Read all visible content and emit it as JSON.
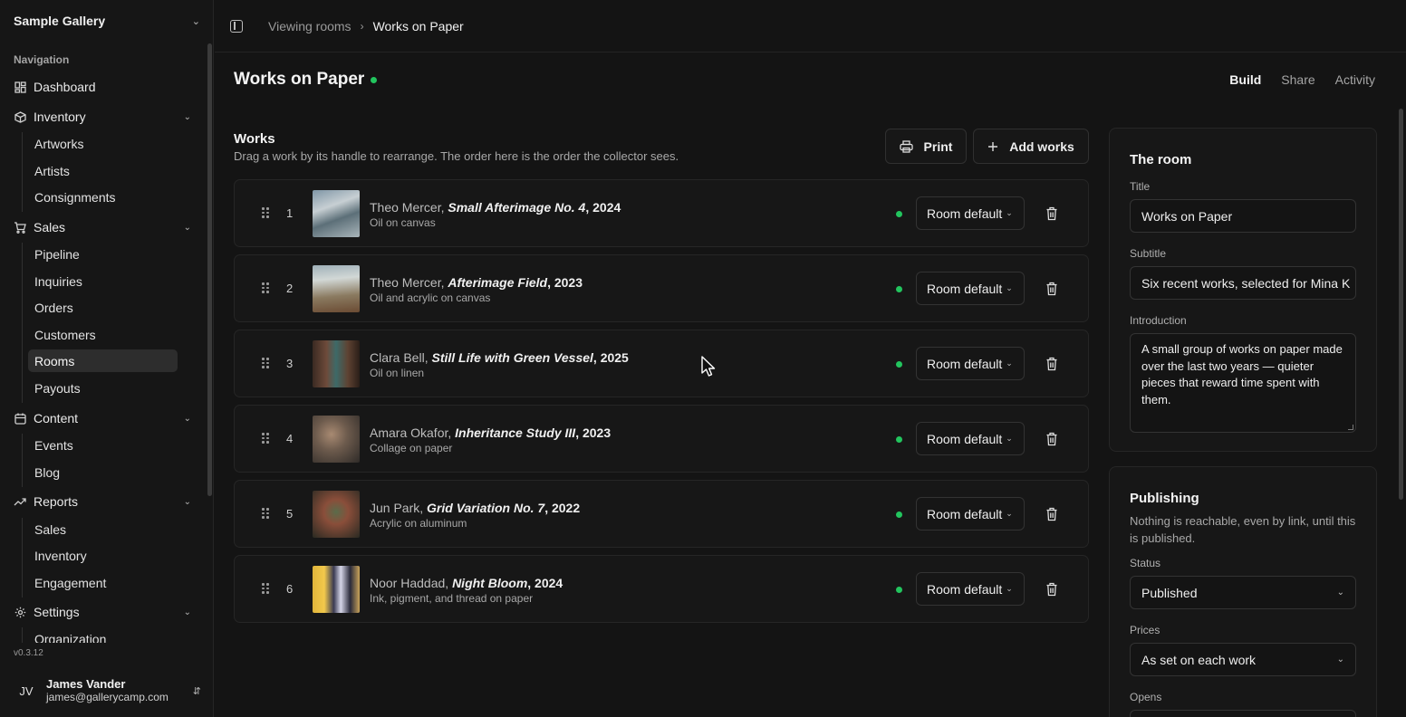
{
  "sidebar": {
    "org_name": "Sample Gallery",
    "nav_heading": "Navigation",
    "dashboard": "Dashboard",
    "inventory": {
      "label": "Inventory",
      "items": [
        "Artworks",
        "Artists",
        "Consignments"
      ]
    },
    "sales": {
      "label": "Sales",
      "items": [
        "Pipeline",
        "Inquiries",
        "Orders",
        "Customers",
        "Rooms",
        "Payouts"
      ]
    },
    "content": {
      "label": "Content",
      "items": [
        "Events",
        "Blog"
      ]
    },
    "reports": {
      "label": "Reports",
      "items": [
        "Sales",
        "Inventory",
        "Engagement"
      ]
    },
    "settings": {
      "label": "Settings",
      "items": [
        "Organization"
      ]
    },
    "active_item": "Rooms",
    "version": "v0.3.12",
    "user": {
      "initials": "JV",
      "name": "James Vander",
      "email": "james@gallerycamp.com"
    }
  },
  "breadcrumb": {
    "parent": "Viewing rooms",
    "current": "Works on Paper"
  },
  "page": {
    "title": "Works on Paper",
    "status_color": "#22c55e",
    "tabs": [
      "Build",
      "Share",
      "Activity"
    ],
    "active_tab": "Build"
  },
  "works": {
    "heading": "Works",
    "description": "Drag a work by its handle to rearrange. The order here is the order the collector sees.",
    "print_label": "Print",
    "add_label": "Add works",
    "items": [
      {
        "num": "1",
        "artist": "Theo Mercer,",
        "title": "Small Afterimage No. 4",
        "year": ", 2024",
        "medium": "Oil on canvas",
        "price_mode": "Room default"
      },
      {
        "num": "2",
        "artist": "Theo Mercer,",
        "title": "Afterimage Field",
        "year": ", 2023",
        "medium": "Oil and acrylic on canvas",
        "price_mode": "Room default"
      },
      {
        "num": "3",
        "artist": "Clara Bell,",
        "title": "Still Life with Green Vessel",
        "year": ", 2025",
        "medium": "Oil on linen",
        "price_mode": "Room default"
      },
      {
        "num": "4",
        "artist": "Amara Okafor,",
        "title": "Inheritance Study III",
        "year": ", 2023",
        "medium": "Collage on paper",
        "price_mode": "Room default"
      },
      {
        "num": "5",
        "artist": "Jun Park,",
        "title": "Grid Variation No. 7",
        "year": ", 2022",
        "medium": "Acrylic on aluminum",
        "price_mode": "Room default"
      },
      {
        "num": "6",
        "artist": "Noor Haddad,",
        "title": "Night Bloom",
        "year": ", 2024",
        "medium": "Ink, pigment, and thread on paper",
        "price_mode": "Room default"
      }
    ]
  },
  "room": {
    "heading": "The room",
    "title_label": "Title",
    "title_value": "Works on Paper",
    "subtitle_label": "Subtitle",
    "subtitle_value": "Six recent works, selected for Mina K",
    "intro_label": "Introduction",
    "intro_value": "A small group of works on paper made over the last two years — quieter pieces that reward time spent with them."
  },
  "publishing": {
    "heading": "Publishing",
    "description": "Nothing is reachable, even by link, until this is published.",
    "status_label": "Status",
    "status_value": "Published",
    "prices_label": "Prices",
    "prices_value": "As set on each work",
    "opens_label": "Opens"
  }
}
